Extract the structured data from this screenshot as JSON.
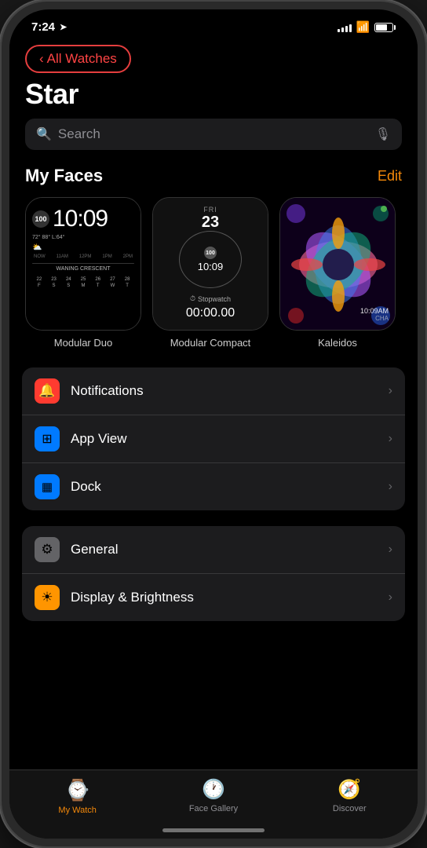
{
  "status_bar": {
    "time": "7:24",
    "location": true,
    "signal_bars": [
      3,
      5,
      7,
      9,
      11
    ],
    "wifi": "wifi",
    "battery_percent": 70
  },
  "back_button": {
    "label": "All Watches",
    "chevron": "‹"
  },
  "page": {
    "title": "Star"
  },
  "search": {
    "placeholder": "Search"
  },
  "my_faces": {
    "label": "My Faces",
    "edit_label": "Edit",
    "faces": [
      {
        "id": "modular-duo",
        "label": "Modular Duo",
        "time": "10:09",
        "badge": "100",
        "weather": "72° 88° L:64°",
        "weather_row": "NOW 11AM 12PM 1PM 2PM",
        "calendar_label": "WANING CRESCENT",
        "calendar_days": [
          "F",
          "S",
          "S",
          "M",
          "T",
          "W",
          "T"
        ],
        "calendar_dates": [
          "22",
          "23",
          "24",
          "25",
          "26",
          "27",
          "28"
        ]
      },
      {
        "id": "modular-compact",
        "label": "Modular Compact",
        "date_day": "FRI",
        "date_num": "23",
        "time": "10:09",
        "badge": "100",
        "stopwatch_label": "Stopwatch",
        "timer": "00:00.00"
      },
      {
        "id": "kaleidoscope",
        "label": "Kaleidos",
        "time_label": "10:09AM",
        "sub_label": "CHA"
      }
    ]
  },
  "settings_groups": [
    {
      "id": "group1",
      "items": [
        {
          "id": "notifications",
          "icon": "🔔",
          "icon_bg": "red",
          "label": "Notifications",
          "has_chevron": true
        },
        {
          "id": "app-view",
          "icon": "⊞",
          "icon_bg": "blue",
          "label": "App View",
          "has_chevron": true
        },
        {
          "id": "dock",
          "icon": "▦",
          "icon_bg": "blue2",
          "label": "Dock",
          "has_chevron": true
        }
      ]
    },
    {
      "id": "group2",
      "items": [
        {
          "id": "general",
          "icon": "⚙",
          "icon_bg": "gray",
          "label": "General",
          "has_chevron": true
        },
        {
          "id": "display-brightness",
          "icon": "☀",
          "icon_bg": "orange",
          "label": "Display & Brightness",
          "has_chevron": true
        }
      ]
    }
  ],
  "tab_bar": {
    "tabs": [
      {
        "id": "my-watch",
        "label": "My Watch",
        "icon": "⌚",
        "active": true
      },
      {
        "id": "face-gallery",
        "label": "Face Gallery",
        "icon": "🕐",
        "active": false
      },
      {
        "id": "discover",
        "label": "Discover",
        "icon": "🧭",
        "active": false
      }
    ]
  }
}
